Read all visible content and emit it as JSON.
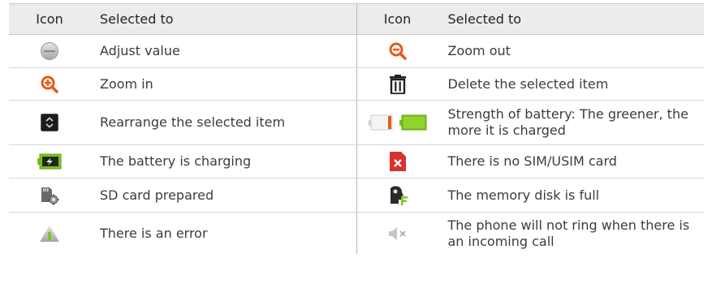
{
  "header": {
    "left_icon_col": "Icon",
    "left_text_col": "Selected to",
    "right_icon_col": "Icon",
    "right_text_col": "Selected to"
  },
  "rows": [
    {
      "left": {
        "icon": "adjust-value-icon",
        "text": "Adjust value"
      },
      "right": {
        "icon": "zoom-out-icon",
        "text": "Zoom out"
      }
    },
    {
      "left": {
        "icon": "zoom-in-icon",
        "text": "Zoom in"
      },
      "right": {
        "icon": "delete-icon",
        "text": "Delete the selected item"
      }
    },
    {
      "left": {
        "icon": "rearrange-icon",
        "text": "Rearrange the selected item"
      },
      "right": {
        "icon": "battery-strength-icon",
        "text": "Strength of battery: The greener, the more it is charged"
      }
    },
    {
      "left": {
        "icon": "battery-charging-icon",
        "text": "The battery is charging"
      },
      "right": {
        "icon": "no-sim-icon",
        "text": "There is no SIM/USIM card"
      }
    },
    {
      "left": {
        "icon": "sd-card-prepared-icon",
        "text": "SD card prepared"
      },
      "right": {
        "icon": "memory-full-icon",
        "text": "The memory disk is full"
      }
    },
    {
      "left": {
        "icon": "error-icon",
        "text": "There is an error"
      },
      "right": {
        "icon": "silent-ring-icon",
        "text": "The phone will not ring when there is an incoming call"
      }
    }
  ],
  "colors": {
    "accent_orange": "#e8581c",
    "battery_green": "#7fc41c",
    "sim_red": "#d93030",
    "header_bg": "#ececec"
  }
}
